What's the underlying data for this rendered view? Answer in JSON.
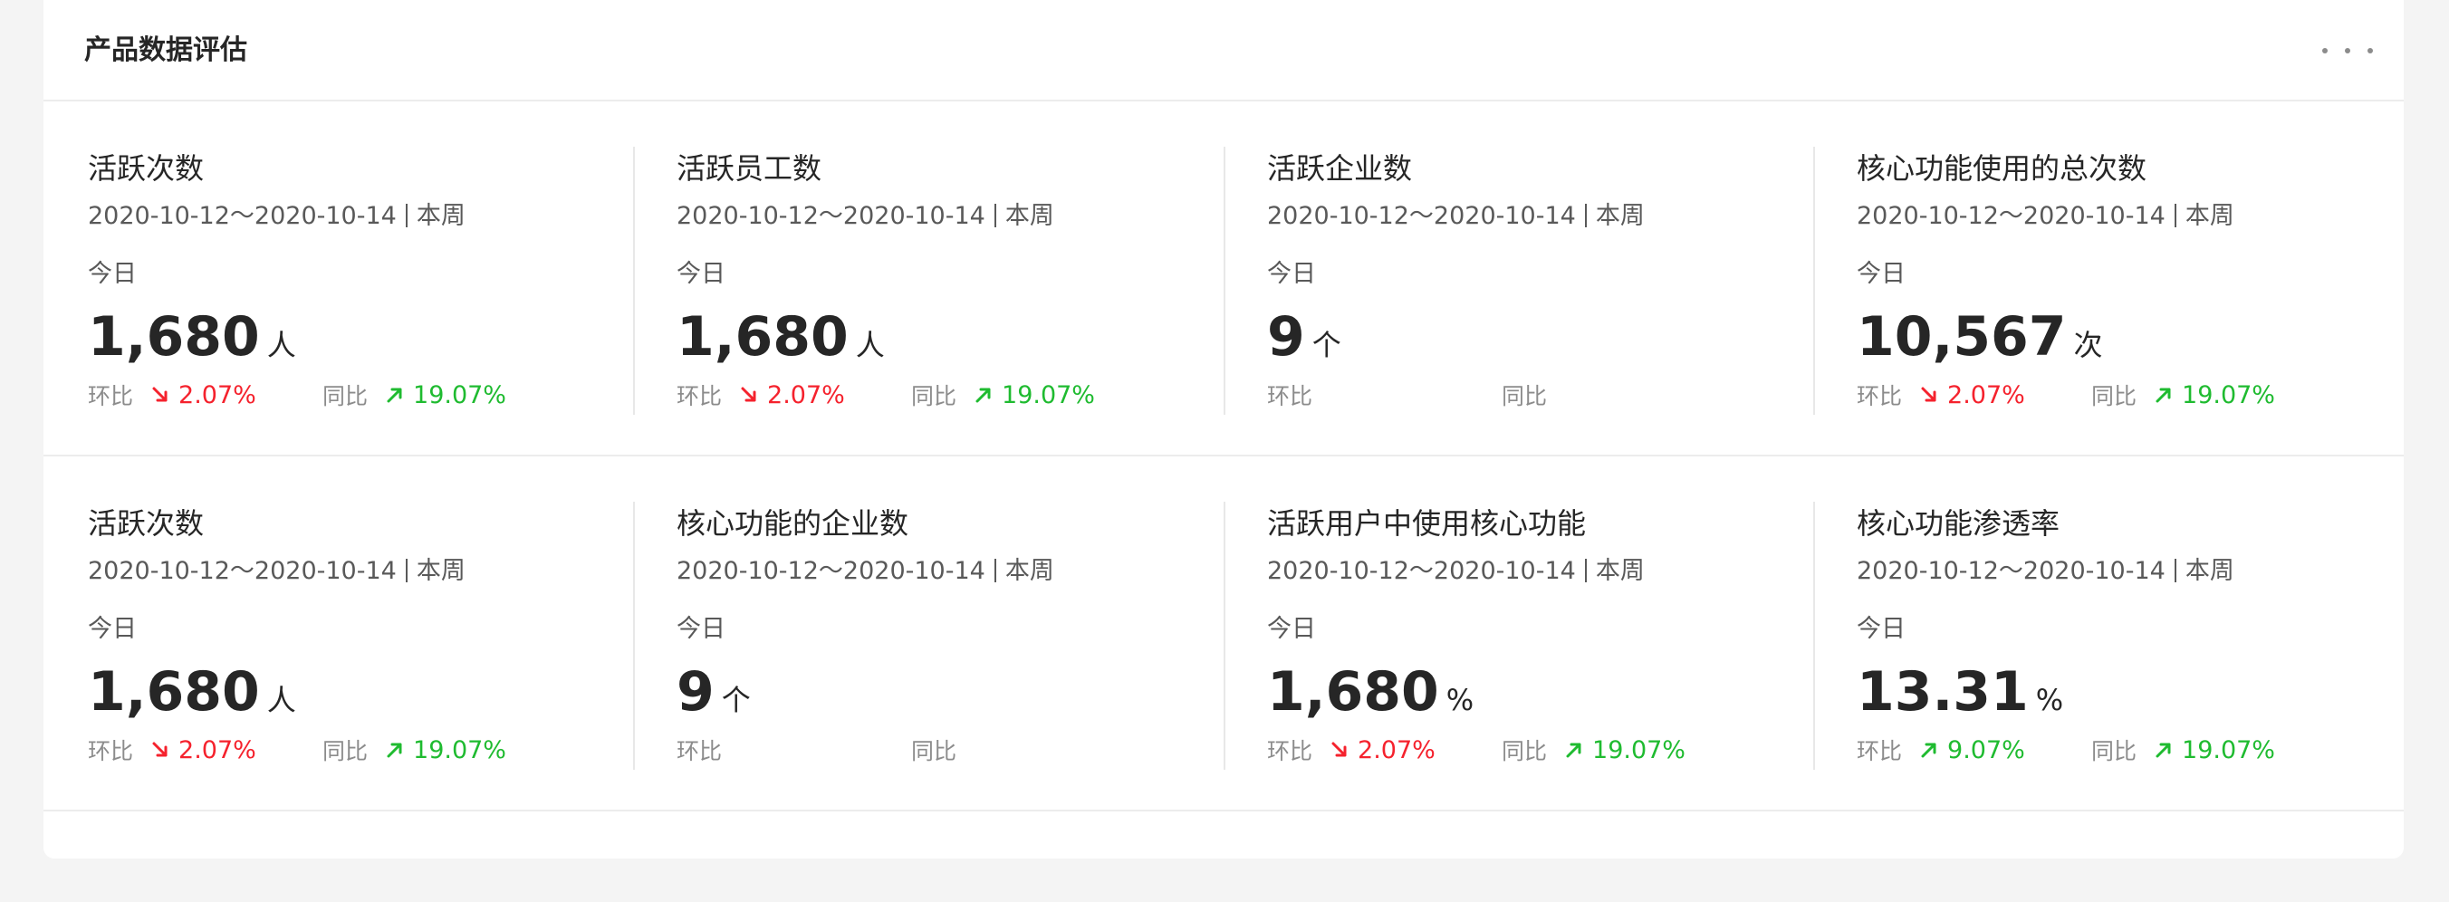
{
  "panel": {
    "title": "产品数据评估",
    "more_icon": "more-horizontal-icon"
  },
  "colors": {
    "down": "#f5222d",
    "up": "#1fbb30"
  },
  "rows": [
    {
      "cards": [
        {
          "name": "活跃次数",
          "date": "2020-10-12～2020-10-14",
          "range": "本周",
          "period": "今日",
          "value": "1,680",
          "unit": "人",
          "mom": {
            "label": "环比",
            "value": "2.07%",
            "trend": "down",
            "icon": "arrow-down-right-icon"
          },
          "yoy": {
            "label": "同比",
            "value": "19.07%",
            "trend": "up",
            "icon": "arrow-up-right-icon"
          }
        },
        {
          "name": "活跃员工数",
          "date": "2020-10-12～2020-10-14",
          "range": "本周",
          "period": "今日",
          "value": "1,680",
          "unit": "人",
          "mom": {
            "label": "环比",
            "value": "2.07%",
            "trend": "down",
            "icon": "arrow-down-right-icon"
          },
          "yoy": {
            "label": "同比",
            "value": "19.07%",
            "trend": "up",
            "icon": "arrow-up-right-icon"
          }
        },
        {
          "name": "活跃企业数",
          "date": "2020-10-12～2020-10-14",
          "range": "本周",
          "period": "今日",
          "value": "9",
          "unit": "个",
          "mom": {
            "label": "环比",
            "value": "",
            "trend": "",
            "icon": ""
          },
          "yoy": {
            "label": "同比",
            "value": "",
            "trend": "",
            "icon": ""
          }
        },
        {
          "name": "核心功能使用的总次数",
          "date": "2020-10-12～2020-10-14",
          "range": "本周",
          "period": "今日",
          "value": "10,567",
          "unit": "次",
          "mom": {
            "label": "环比",
            "value": "2.07%",
            "trend": "down",
            "icon": "arrow-down-right-icon"
          },
          "yoy": {
            "label": "同比",
            "value": "19.07%",
            "trend": "up",
            "icon": "arrow-up-right-icon"
          }
        }
      ]
    },
    {
      "cards": [
        {
          "name": "活跃次数",
          "date": "2020-10-12～2020-10-14",
          "range": "本周",
          "period": "今日",
          "value": "1,680",
          "unit": "人",
          "mom": {
            "label": "环比",
            "value": "2.07%",
            "trend": "down",
            "icon": "arrow-down-right-icon"
          },
          "yoy": {
            "label": "同比",
            "value": "19.07%",
            "trend": "up",
            "icon": "arrow-up-right-icon"
          }
        },
        {
          "name": "核心功能的企业数",
          "date": "2020-10-12～2020-10-14",
          "range": "本周",
          "period": "今日",
          "value": "9",
          "unit": "个",
          "mom": {
            "label": "环比",
            "value": "",
            "trend": "",
            "icon": ""
          },
          "yoy": {
            "label": "同比",
            "value": "",
            "trend": "",
            "icon": ""
          }
        },
        {
          "name": "活跃用户中使用核心功能",
          "date": "2020-10-12～2020-10-14",
          "range": "本周",
          "period": "今日",
          "value": "1,680",
          "unit": "%",
          "mom": {
            "label": "环比",
            "value": "2.07%",
            "trend": "down",
            "icon": "arrow-down-right-icon"
          },
          "yoy": {
            "label": "同比",
            "value": "19.07%",
            "trend": "up",
            "icon": "arrow-up-right-icon"
          }
        },
        {
          "name": "核心功能渗透率",
          "date": "2020-10-12～2020-10-14",
          "range": "本周",
          "period": "今日",
          "value": "13.31",
          "unit": "%",
          "mom": {
            "label": "环比",
            "value": "9.07%",
            "trend": "up",
            "icon": "arrow-up-right-icon"
          },
          "yoy": {
            "label": "同比",
            "value": "19.07%",
            "trend": "up",
            "icon": "arrow-up-right-icon"
          }
        }
      ]
    }
  ]
}
